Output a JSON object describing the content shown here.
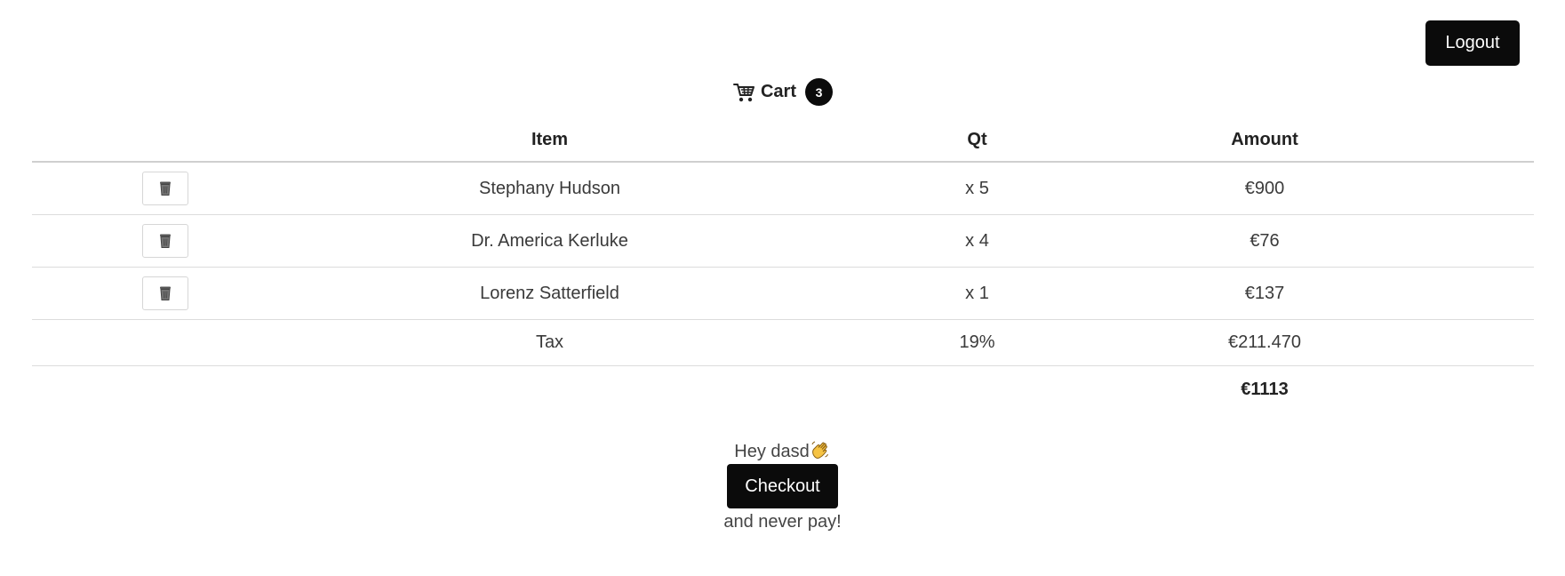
{
  "header": {
    "logout_label": "Logout"
  },
  "cart": {
    "title": "Cart",
    "count": "3",
    "icon": "shopping-cart-icon"
  },
  "table": {
    "columns": [
      "",
      "Item",
      "Qt",
      "Amount"
    ],
    "rows": [
      {
        "item": "Stephany Hudson",
        "qty": "x 5",
        "amount": "€900",
        "action_icon": "trash-icon"
      },
      {
        "item": "Dr. America Kerluke",
        "qty": "x 4",
        "amount": "€76",
        "action_icon": "trash-icon"
      },
      {
        "item": "Lorenz Satterfield",
        "qty": "x 1",
        "amount": "€137",
        "action_icon": "trash-icon"
      }
    ],
    "tax": {
      "label": "Tax",
      "rate": "19%",
      "amount": "€211.470"
    },
    "total": "€1113"
  },
  "footer": {
    "greeting": "Hey dasd",
    "greeting_icon": "waving-hand-icon",
    "checkout_label": "Checkout",
    "tagline": "and never pay!"
  },
  "colors": {
    "button_bg": "#0b0b0b",
    "button_text": "#ffffff"
  }
}
